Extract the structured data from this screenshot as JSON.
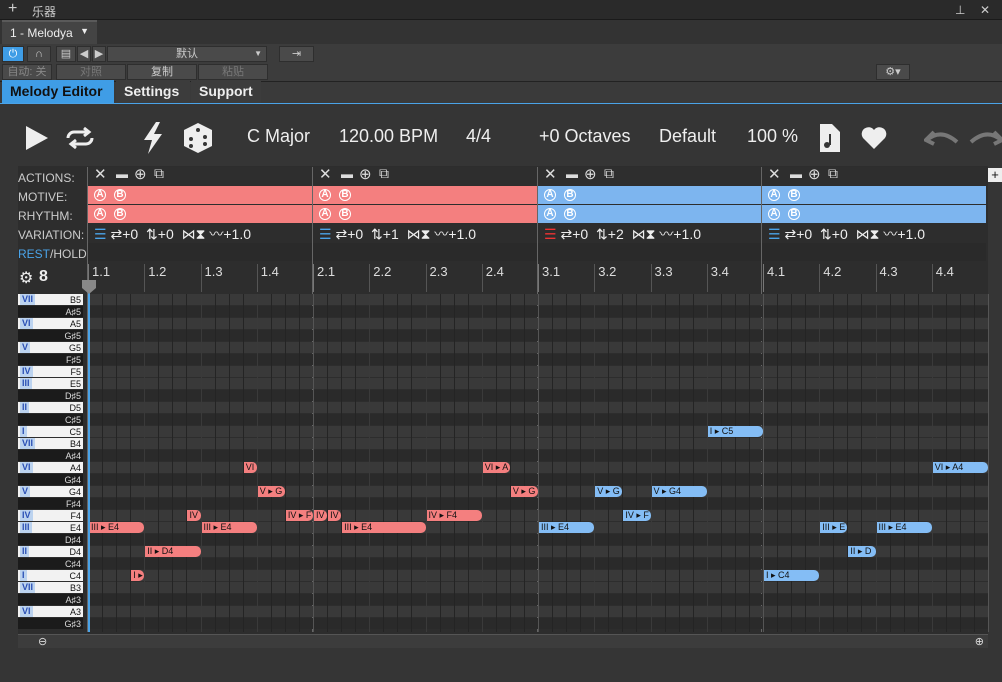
{
  "window": {
    "title": "乐器",
    "tab": "1 - Melodya"
  },
  "host": {
    "preset": "默认",
    "auto_label": "自动: 关",
    "compare_label": "对照",
    "copy_label": "复制",
    "paste_label": "粘贴"
  },
  "tabs": [
    {
      "label": "Melody Editor",
      "active": true
    },
    {
      "label": "Settings",
      "active": false
    },
    {
      "label": "Support",
      "active": false
    }
  ],
  "toolbar": {
    "key": "C Major",
    "tempo": "120.00 BPM",
    "time_sig": "4/4",
    "octaves": "+0 Octaves",
    "preset": "Default",
    "zoom": "100 %"
  },
  "row_labels": {
    "actions": "ACTIONS:",
    "motive": "MOTIVE:",
    "rhythm": "RHYTHM:",
    "variation": "VARIATION:",
    "rest": "REST",
    "hold": "HOLD:",
    "slash": "/"
  },
  "segments": [
    {
      "color": "red",
      "shift": "+0",
      "transpose": "+0",
      "humanize": "+1.0"
    },
    {
      "color": "red",
      "shift": "+0",
      "transpose": "+1",
      "humanize": "+1.0"
    },
    {
      "color": "blue",
      "shift": "+0",
      "transpose": "+2",
      "humanize": "+1.0"
    },
    {
      "color": "blue",
      "shift": "+0",
      "transpose": "+0",
      "humanize": "+1.0"
    }
  ],
  "beats": [
    "1.1",
    "1.2",
    "1.3",
    "1.4",
    "2.1",
    "2.2",
    "2.3",
    "2.4",
    "3.1",
    "3.2",
    "3.3",
    "3.4",
    "4.1",
    "4.2",
    "4.3",
    "4.4"
  ],
  "keys": [
    {
      "name": "B5",
      "deg": "VII",
      "black": false
    },
    {
      "name": "A♯5",
      "deg": "",
      "black": true
    },
    {
      "name": "A5",
      "deg": "VI",
      "black": false
    },
    {
      "name": "G♯5",
      "deg": "",
      "black": true
    },
    {
      "name": "G5",
      "deg": "V",
      "black": false
    },
    {
      "name": "F♯5",
      "deg": "",
      "black": true
    },
    {
      "name": "F5",
      "deg": "IV",
      "black": false
    },
    {
      "name": "E5",
      "deg": "III",
      "black": false
    },
    {
      "name": "D♯5",
      "deg": "",
      "black": true
    },
    {
      "name": "D5",
      "deg": "II",
      "black": false
    },
    {
      "name": "C♯5",
      "deg": "",
      "black": true
    },
    {
      "name": "C5",
      "deg": "I",
      "black": false
    },
    {
      "name": "B4",
      "deg": "VII",
      "black": false
    },
    {
      "name": "A♯4",
      "deg": "",
      "black": true
    },
    {
      "name": "A4",
      "deg": "VI",
      "black": false
    },
    {
      "name": "G♯4",
      "deg": "",
      "black": true
    },
    {
      "name": "G4",
      "deg": "V",
      "black": false
    },
    {
      "name": "F♯4",
      "deg": "",
      "black": true
    },
    {
      "name": "F4",
      "deg": "IV",
      "black": false
    },
    {
      "name": "E4",
      "deg": "III",
      "black": false
    },
    {
      "name": "D♯4",
      "deg": "",
      "black": true
    },
    {
      "name": "D4",
      "deg": "II",
      "black": false
    },
    {
      "name": "C♯4",
      "deg": "",
      "black": true
    },
    {
      "name": "C4",
      "deg": "I",
      "black": false
    },
    {
      "name": "B3",
      "deg": "VII",
      "black": false
    },
    {
      "name": "A♯3",
      "deg": "",
      "black": true
    },
    {
      "name": "A3",
      "deg": "VI",
      "black": false
    },
    {
      "name": "G♯3",
      "deg": "",
      "black": true
    }
  ],
  "notes": [
    {
      "label": "III ▸ E4",
      "row": 19,
      "start": 0,
      "len": 4,
      "color": "red"
    },
    {
      "label": "I ▸",
      "row": 23,
      "start": 3,
      "len": 1,
      "color": "red"
    },
    {
      "label": "II ▸ D4",
      "row": 21,
      "start": 4,
      "len": 4,
      "color": "red"
    },
    {
      "label": "IV",
      "row": 18,
      "start": 7,
      "len": 1,
      "color": "red"
    },
    {
      "label": "III ▸ E4",
      "row": 19,
      "start": 8,
      "len": 4,
      "color": "red"
    },
    {
      "label": "VI",
      "row": 14,
      "start": 11,
      "len": 1,
      "color": "red"
    },
    {
      "label": "V ▸ G",
      "row": 16,
      "start": 12,
      "len": 2,
      "color": "red"
    },
    {
      "label": "IV ▸ F",
      "row": 18,
      "start": 14,
      "len": 2,
      "color": "red"
    },
    {
      "label": "IV",
      "row": 18,
      "start": 16,
      "len": 1,
      "color": "red"
    },
    {
      "label": "IV",
      "row": 18,
      "start": 17,
      "len": 1,
      "color": "red"
    },
    {
      "label": "III ▸ E4",
      "row": 19,
      "start": 18,
      "len": 6,
      "color": "red"
    },
    {
      "label": "IV ▸ F4",
      "row": 18,
      "start": 24,
      "len": 4,
      "color": "red"
    },
    {
      "label": "VI ▸ A",
      "row": 14,
      "start": 28,
      "len": 2,
      "color": "red"
    },
    {
      "label": "V ▸ G",
      "row": 16,
      "start": 30,
      "len": 2,
      "color": "red"
    },
    {
      "label": "III ▸ E4",
      "row": 19,
      "start": 32,
      "len": 4,
      "color": "blue"
    },
    {
      "label": "V ▸ G",
      "row": 16,
      "start": 36,
      "len": 2,
      "color": "blue"
    },
    {
      "label": "IV ▸ F",
      "row": 18,
      "start": 38,
      "len": 2,
      "color": "blue"
    },
    {
      "label": "V ▸ G4",
      "row": 16,
      "start": 40,
      "len": 4,
      "color": "blue"
    },
    {
      "label": "I ▸ C5",
      "row": 11,
      "start": 44,
      "len": 4,
      "color": "blue"
    },
    {
      "label": "I ▸ C4",
      "row": 23,
      "start": 48,
      "len": 4,
      "color": "blue"
    },
    {
      "label": "III ▸ E",
      "row": 19,
      "start": 52,
      "len": 2,
      "color": "blue"
    },
    {
      "label": "II ▸ D",
      "row": 21,
      "start": 54,
      "len": 2,
      "color": "blue"
    },
    {
      "label": "III ▸ E4",
      "row": 19,
      "start": 56,
      "len": 4,
      "color": "blue"
    },
    {
      "label": "VI ▸ A4",
      "row": 14,
      "start": 60,
      "len": 4,
      "color": "blue"
    }
  ]
}
